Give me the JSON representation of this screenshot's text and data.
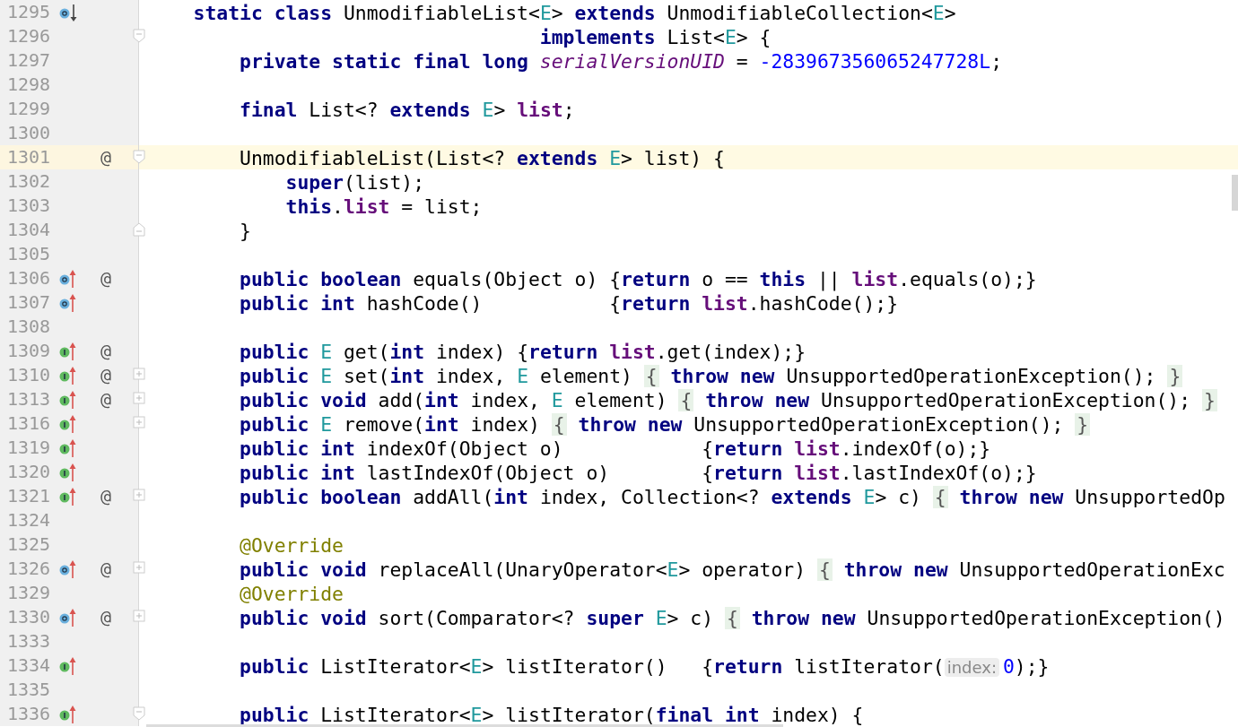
{
  "editor": {
    "lines": [
      {
        "number": "1295",
        "gutter_icon": {
          "kind": "overridden"
        },
        "current": false,
        "tokens": [
          {
            "kind": "keyword",
            "text": "    static class"
          },
          {
            "kind": "plain",
            "text": " UnmodifiableList<"
          },
          {
            "kind": "type",
            "text": "E"
          },
          {
            "kind": "plain",
            "text": "> "
          },
          {
            "kind": "keyword",
            "text": "extends"
          },
          {
            "kind": "plain",
            "text": " UnmodifiableCollection<"
          },
          {
            "kind": "type",
            "text": "E"
          },
          {
            "kind": "plain",
            "text": ">"
          }
        ]
      },
      {
        "number": "1296",
        "fold": {
          "kind": "start"
        },
        "current": false,
        "tokens": [
          {
            "kind": "keyword",
            "text": "                                  implements"
          },
          {
            "kind": "plain",
            "text": " List<"
          },
          {
            "kind": "type",
            "text": "E"
          },
          {
            "kind": "plain",
            "text": "> {"
          }
        ]
      },
      {
        "number": "1297",
        "current": false,
        "tokens": [
          {
            "kind": "keyword",
            "text": "        private static final long"
          },
          {
            "kind": "static-field",
            "text": " serialVersionUID"
          },
          {
            "kind": "plain",
            "text": " = "
          },
          {
            "kind": "number",
            "text": "-283967356065247728L"
          },
          {
            "kind": "plain",
            "text": ";"
          }
        ]
      },
      {
        "number": "1298",
        "current": false
      },
      {
        "number": "1299",
        "current": false,
        "tokens": [
          {
            "kind": "keyword",
            "text": "        final"
          },
          {
            "kind": "plain",
            "text": " List<? "
          },
          {
            "kind": "keyword",
            "text": "extends"
          },
          {
            "kind": "type",
            "text": " E"
          },
          {
            "kind": "plain",
            "text": "> "
          },
          {
            "kind": "field",
            "text": "list"
          },
          {
            "kind": "plain",
            "text": ";"
          }
        ]
      },
      {
        "number": "1300",
        "current": false
      },
      {
        "number": "1301",
        "marker": "@",
        "fold": {
          "kind": "start"
        },
        "current": true,
        "tokens": [
          {
            "kind": "plain",
            "text": "        UnmodifiableList(List<? "
          },
          {
            "kind": "keyword",
            "text": "extends"
          },
          {
            "kind": "type",
            "text": " E"
          },
          {
            "kind": "plain",
            "text": "> list) {"
          }
        ]
      },
      {
        "number": "1302",
        "current": false,
        "tokens": [
          {
            "kind": "keyword",
            "text": "            super"
          },
          {
            "kind": "plain",
            "text": "(list);"
          }
        ]
      },
      {
        "number": "1303",
        "current": false,
        "tokens": [
          {
            "kind": "keyword",
            "text": "            this"
          },
          {
            "kind": "plain",
            "text": "."
          },
          {
            "kind": "field",
            "text": "list"
          },
          {
            "kind": "plain",
            "text": " = list;"
          }
        ]
      },
      {
        "number": "1304",
        "fold": {
          "kind": "end"
        },
        "current": false,
        "tokens": [
          {
            "kind": "plain",
            "text": "        }"
          }
        ]
      },
      {
        "number": "1305",
        "current": false
      },
      {
        "number": "1306",
        "gutter_icon": {
          "kind": "overrides"
        },
        "marker": "@",
        "current": false,
        "tokens": [
          {
            "kind": "keyword",
            "text": "        public boolean"
          },
          {
            "kind": "plain",
            "text": " equals(Object o) {"
          },
          {
            "kind": "keyword",
            "text": "return"
          },
          {
            "kind": "plain",
            "text": " o == "
          },
          {
            "kind": "keyword",
            "text": "this"
          },
          {
            "kind": "plain",
            "text": " || "
          },
          {
            "kind": "field",
            "text": "list"
          },
          {
            "kind": "plain",
            "text": ".equals(o);}"
          }
        ]
      },
      {
        "number": "1307",
        "gutter_icon": {
          "kind": "overrides"
        },
        "current": false,
        "tokens": [
          {
            "kind": "keyword",
            "text": "        public int"
          },
          {
            "kind": "plain",
            "text": " hashCode()           {"
          },
          {
            "kind": "keyword",
            "text": "return"
          },
          {
            "kind": "field",
            "text": " list"
          },
          {
            "kind": "plain",
            "text": ".hashCode();}"
          }
        ]
      },
      {
        "number": "1308",
        "current": false
      },
      {
        "number": "1309",
        "gutter_icon": {
          "kind": "implements"
        },
        "marker": "@",
        "current": false,
        "tokens": [
          {
            "kind": "keyword",
            "text": "        public"
          },
          {
            "kind": "type",
            "text": " E"
          },
          {
            "kind": "plain",
            "text": " get("
          },
          {
            "kind": "keyword",
            "text": "int"
          },
          {
            "kind": "plain",
            "text": " index) {"
          },
          {
            "kind": "keyword",
            "text": "return"
          },
          {
            "kind": "field",
            "text": " list"
          },
          {
            "kind": "plain",
            "text": ".get(index);}"
          }
        ]
      },
      {
        "number": "1310",
        "gutter_icon": {
          "kind": "implements"
        },
        "marker": "@",
        "fold": {
          "kind": "collapsed"
        },
        "current": false,
        "tokens": [
          {
            "kind": "keyword",
            "text": "        public"
          },
          {
            "kind": "type",
            "text": " E"
          },
          {
            "kind": "plain",
            "text": " set("
          },
          {
            "kind": "keyword",
            "text": "int"
          },
          {
            "kind": "plain",
            "text": " index, "
          },
          {
            "kind": "type",
            "text": "E"
          },
          {
            "kind": "plain",
            "text": " element) "
          },
          {
            "kind": "folded",
            "text": "{"
          },
          {
            "kind": "keyword",
            "text": " throw new"
          },
          {
            "kind": "plain",
            "text": " UnsupportedOperationException(); "
          },
          {
            "kind": "folded",
            "text": "}"
          }
        ]
      },
      {
        "number": "1313",
        "gutter_icon": {
          "kind": "implements"
        },
        "marker": "@",
        "fold": {
          "kind": "collapsed"
        },
        "current": false,
        "tokens": [
          {
            "kind": "keyword",
            "text": "        public void"
          },
          {
            "kind": "plain",
            "text": " add("
          },
          {
            "kind": "keyword",
            "text": "int"
          },
          {
            "kind": "plain",
            "text": " index, "
          },
          {
            "kind": "type",
            "text": "E"
          },
          {
            "kind": "plain",
            "text": " element) "
          },
          {
            "kind": "folded",
            "text": "{"
          },
          {
            "kind": "keyword",
            "text": " throw new"
          },
          {
            "kind": "plain",
            "text": " UnsupportedOperationException(); "
          },
          {
            "kind": "folded",
            "text": "}"
          }
        ]
      },
      {
        "number": "1316",
        "gutter_icon": {
          "kind": "implements"
        },
        "fold": {
          "kind": "collapsed"
        },
        "current": false,
        "tokens": [
          {
            "kind": "keyword",
            "text": "        public"
          },
          {
            "kind": "type",
            "text": " E"
          },
          {
            "kind": "plain",
            "text": " remove("
          },
          {
            "kind": "keyword",
            "text": "int"
          },
          {
            "kind": "plain",
            "text": " index) "
          },
          {
            "kind": "folded",
            "text": "{"
          },
          {
            "kind": "keyword",
            "text": " throw new"
          },
          {
            "kind": "plain",
            "text": " UnsupportedOperationException(); "
          },
          {
            "kind": "folded",
            "text": "}"
          }
        ]
      },
      {
        "number": "1319",
        "gutter_icon": {
          "kind": "implements"
        },
        "current": false,
        "tokens": [
          {
            "kind": "keyword",
            "text": "        public int"
          },
          {
            "kind": "plain",
            "text": " indexOf(Object o)            {"
          },
          {
            "kind": "keyword",
            "text": "return"
          },
          {
            "kind": "field",
            "text": " list"
          },
          {
            "kind": "plain",
            "text": ".indexOf(o);}"
          }
        ]
      },
      {
        "number": "1320",
        "gutter_icon": {
          "kind": "implements"
        },
        "current": false,
        "tokens": [
          {
            "kind": "keyword",
            "text": "        public int"
          },
          {
            "kind": "plain",
            "text": " lastIndexOf(Object o)        {"
          },
          {
            "kind": "keyword",
            "text": "return"
          },
          {
            "kind": "field",
            "text": " list"
          },
          {
            "kind": "plain",
            "text": ".lastIndexOf(o);}"
          }
        ]
      },
      {
        "number": "1321",
        "gutter_icon": {
          "kind": "implements"
        },
        "marker": "@",
        "fold": {
          "kind": "collapsed"
        },
        "current": false,
        "tokens": [
          {
            "kind": "keyword",
            "text": "        public boolean"
          },
          {
            "kind": "plain",
            "text": " addAll("
          },
          {
            "kind": "keyword",
            "text": "int"
          },
          {
            "kind": "plain",
            "text": " index, Collection<? "
          },
          {
            "kind": "keyword",
            "text": "extends"
          },
          {
            "kind": "type",
            "text": " E"
          },
          {
            "kind": "plain",
            "text": "> c) "
          },
          {
            "kind": "folded",
            "text": "{"
          },
          {
            "kind": "keyword",
            "text": " throw new"
          },
          {
            "kind": "plain",
            "text": " UnsupportedOp"
          }
        ]
      },
      {
        "number": "1324",
        "current": false
      },
      {
        "number": "1325",
        "current": false,
        "tokens": [
          {
            "kind": "annotation",
            "text": "        @Override"
          }
        ]
      },
      {
        "number": "1326",
        "gutter_icon": {
          "kind": "overrides"
        },
        "marker": "@",
        "fold": {
          "kind": "collapsed"
        },
        "current": false,
        "tokens": [
          {
            "kind": "keyword",
            "text": "        public void"
          },
          {
            "kind": "plain",
            "text": " replaceAll(UnaryOperator<"
          },
          {
            "kind": "type",
            "text": "E"
          },
          {
            "kind": "plain",
            "text": "> operator) "
          },
          {
            "kind": "folded",
            "text": "{"
          },
          {
            "kind": "keyword",
            "text": " throw new"
          },
          {
            "kind": "plain",
            "text": " UnsupportedOperationExc"
          }
        ]
      },
      {
        "number": "1329",
        "current": false,
        "tokens": [
          {
            "kind": "annotation",
            "text": "        @Override"
          }
        ]
      },
      {
        "number": "1330",
        "gutter_icon": {
          "kind": "overrides"
        },
        "marker": "@",
        "fold": {
          "kind": "collapsed"
        },
        "current": false,
        "tokens": [
          {
            "kind": "keyword",
            "text": "        public void"
          },
          {
            "kind": "plain",
            "text": " sort(Comparator<? "
          },
          {
            "kind": "keyword",
            "text": "super"
          },
          {
            "kind": "type",
            "text": " E"
          },
          {
            "kind": "plain",
            "text": "> c) "
          },
          {
            "kind": "folded",
            "text": "{"
          },
          {
            "kind": "keyword",
            "text": " throw new"
          },
          {
            "kind": "plain",
            "text": " UnsupportedOperationException()"
          }
        ]
      },
      {
        "number": "1333",
        "current": false
      },
      {
        "number": "1334",
        "gutter_icon": {
          "kind": "implements"
        },
        "current": false,
        "tokens": [
          {
            "kind": "keyword",
            "text": "        public"
          },
          {
            "kind": "plain",
            "text": " ListIterator<"
          },
          {
            "kind": "type",
            "text": "E"
          },
          {
            "kind": "plain",
            "text": "> listIterator()   {"
          },
          {
            "kind": "keyword",
            "text": "return"
          },
          {
            "kind": "plain",
            "text": " listIterator("
          },
          {
            "kind": "hint",
            "text": "index:"
          },
          {
            "kind": "number",
            "text": "0"
          },
          {
            "kind": "plain",
            "text": ");}"
          }
        ]
      },
      {
        "number": "1335",
        "current": false
      },
      {
        "number": "1336",
        "gutter_icon": {
          "kind": "implements"
        },
        "fold": {
          "kind": "start"
        },
        "current": false,
        "tokens": [
          {
            "kind": "keyword",
            "text": "        public"
          },
          {
            "kind": "plain",
            "text": " ListIterator<"
          },
          {
            "kind": "type",
            "text": "E"
          },
          {
            "kind": "plain",
            "text": "> listIterator("
          },
          {
            "kind": "keyword",
            "text": "final int"
          },
          {
            "kind": "plain",
            "text": " index) {"
          }
        ]
      }
    ]
  }
}
